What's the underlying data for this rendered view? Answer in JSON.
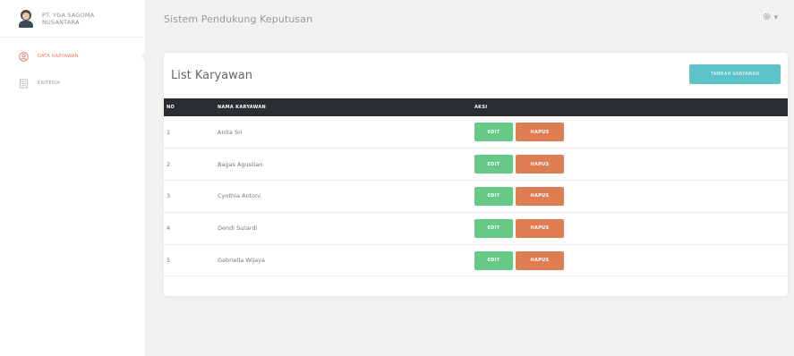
{
  "brand": {
    "line1": "PT. YGA SAGOMA",
    "line2": "NUSANTARA"
  },
  "sidebar": {
    "items": [
      {
        "label": "DATA KARYAWAN",
        "icon": "user-circle-icon",
        "active": true
      },
      {
        "label": "KRITERIA",
        "icon": "list-icon",
        "active": false
      }
    ]
  },
  "topbar": {
    "title": "Sistem Pendukung Keputusan",
    "settings_icon": "gear-icon",
    "caret": "▾"
  },
  "card": {
    "title": "List Karyawan",
    "add_button": "TAMBAH KARYAWAN"
  },
  "table": {
    "headers": {
      "no": "NO",
      "name": "NAMA KARYAWAN",
      "action": "AKSI"
    },
    "rows": [
      {
        "no": "1",
        "name": "Anita Sri"
      },
      {
        "no": "2",
        "name": "Bagas Agustian"
      },
      {
        "no": "3",
        "name": "Cynthia Antoni"
      },
      {
        "no": "4",
        "name": "Dendi Sutardi"
      },
      {
        "no": "5",
        "name": "Gabriella Wijaya"
      }
    ],
    "edit_label": "EDIT",
    "delete_label": "HAPUS"
  },
  "colors": {
    "accent_add": "#5bc3c9",
    "edit": "#67c986",
    "delete": "#de7c52",
    "header": "#2a2d31"
  }
}
